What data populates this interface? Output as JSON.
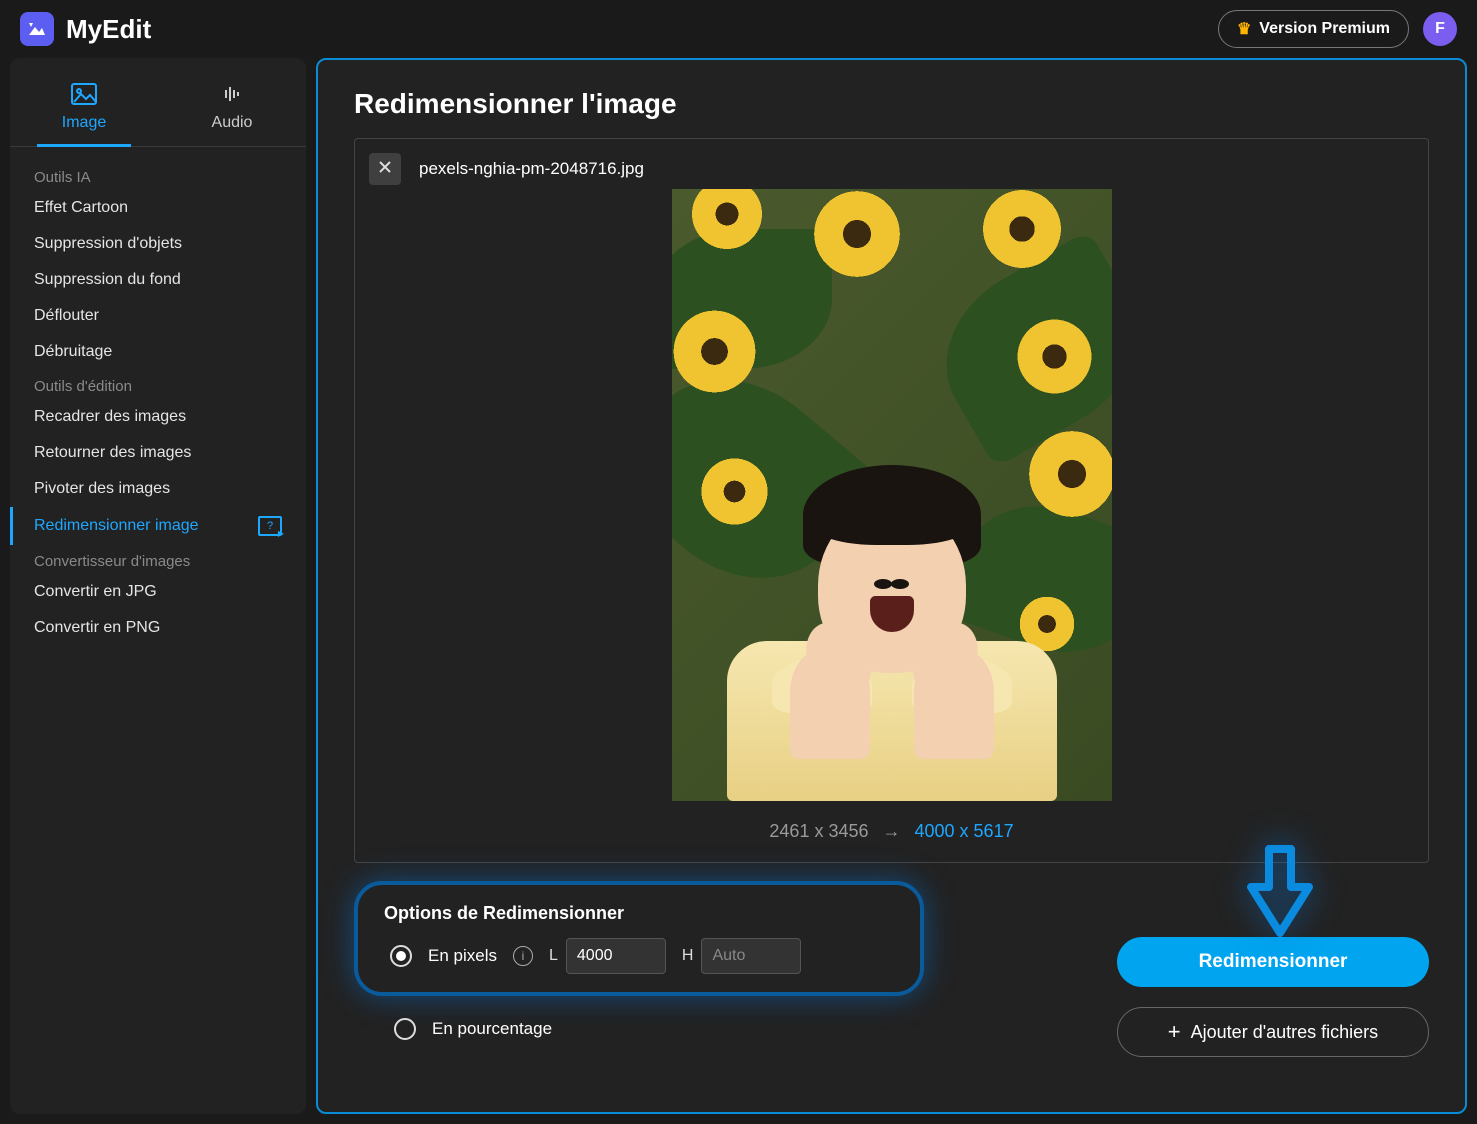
{
  "header": {
    "brand": "MyEdit",
    "premium_label": "Version Premium",
    "avatar_initial": "F"
  },
  "tabs": {
    "image": "Image",
    "audio": "Audio"
  },
  "sidebar": {
    "section_ai": "Outils IA",
    "ai_items": [
      "Effet Cartoon",
      "Suppression d'objets",
      "Suppression du fond",
      "Déflouter",
      "Débruitage"
    ],
    "section_edit": "Outils d'édition",
    "edit_items": [
      "Recadrer des images",
      "Retourner des images",
      "Pivoter des images",
      "Redimensionner image"
    ],
    "section_convert": "Convertisseur d'images",
    "convert_items": [
      "Convertir en JPG",
      "Convertir en PNG"
    ]
  },
  "main": {
    "title": "Redimensionner l'image",
    "filename": "pexels-nghia-pm-2048716.jpg",
    "dims_original": "2461 x 3456",
    "dims_arrow": "→",
    "dims_new": "4000 x 5617"
  },
  "options": {
    "heading": "Options de Redimensionner",
    "mode_pixels": "En pixels",
    "mode_percent": "En pourcentage",
    "width_label": "L",
    "width_value": "4000",
    "height_label": "H",
    "height_placeholder": "Auto"
  },
  "actions": {
    "resize": "Redimensionner",
    "add_more": "Ajouter d'autres fichiers"
  }
}
